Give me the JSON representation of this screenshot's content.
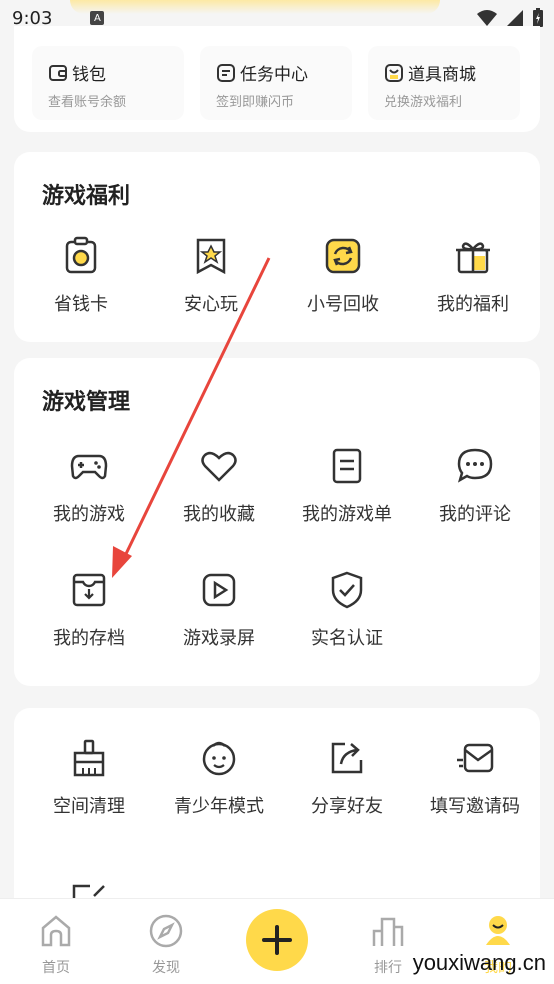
{
  "status": {
    "time": "9:03"
  },
  "shortcuts": [
    {
      "title": "钱包",
      "subtitle": "查看账号余额"
    },
    {
      "title": "任务中心",
      "subtitle": "签到即赚闪币"
    },
    {
      "title": "道具商城",
      "subtitle": "兑换游戏福利"
    }
  ],
  "welfare": {
    "title": "游戏福利",
    "items": [
      "省钱卡",
      "安心玩",
      "小号回收",
      "我的福利"
    ]
  },
  "management": {
    "title": "游戏管理",
    "items": [
      "我的游戏",
      "我的收藏",
      "我的游戏单",
      "我的评论",
      "我的存档",
      "游戏录屏",
      "实名认证"
    ]
  },
  "tools": {
    "items": [
      "空间清理",
      "青少年模式",
      "分享好友",
      "填写邀请码"
    ]
  },
  "nav": {
    "home": "首页",
    "discover": "发现",
    "rank": "排行",
    "mine": "我的"
  },
  "watermark": "youxiwang.cn",
  "colors": {
    "accent": "#ffd94a",
    "annotation_arrow": "#e8453c"
  }
}
